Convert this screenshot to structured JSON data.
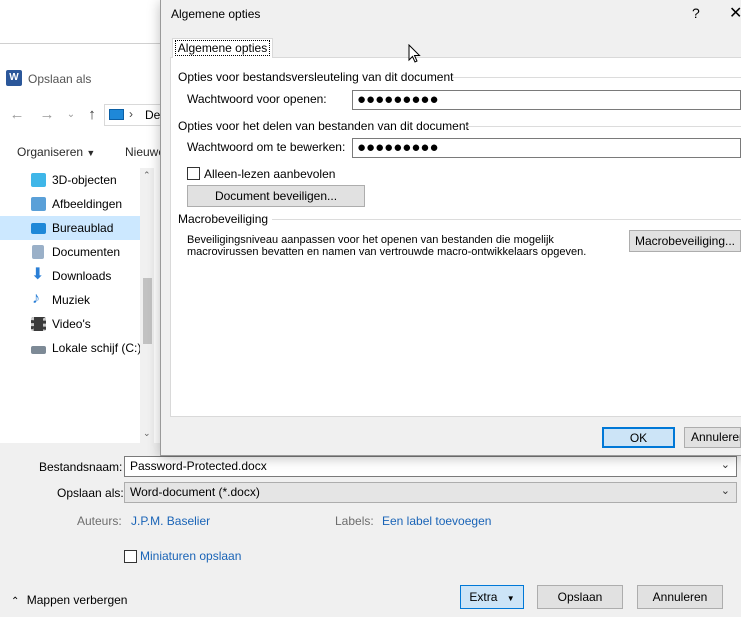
{
  "save_as": {
    "title": "Opslaan als",
    "address_text": "Dez",
    "toolbar": {
      "organize": "Organiseren",
      "new_folder": "Nieuwe"
    },
    "tree": [
      {
        "label": "3D-objecten",
        "icon": "3d-objects-icon",
        "color": "#3fb6e8"
      },
      {
        "label": "Afbeeldingen",
        "icon": "pictures-icon",
        "color": "#5aa0d8"
      },
      {
        "label": "Bureaublad",
        "icon": "desktop-icon",
        "color": "#1e88d8",
        "selected": true
      },
      {
        "label": "Documenten",
        "icon": "documents-icon",
        "color": "#9ab0c8"
      },
      {
        "label": "Downloads",
        "icon": "downloads-icon",
        "color": "#2a7fd6"
      },
      {
        "label": "Muziek",
        "icon": "music-icon",
        "color": "#2a7fd6"
      },
      {
        "label": "Video's",
        "icon": "videos-icon",
        "color": "#3a3a3a"
      },
      {
        "label": "Lokale schijf (C:)",
        "icon": "drive-icon",
        "color": "#7d8a96"
      }
    ],
    "filename_label": "Bestandsnaam:",
    "filename_value": "Password-Protected.docx",
    "savetype_label": "Opslaan als:",
    "savetype_value": "Word-document (*.docx)",
    "authors_label": "Auteurs:",
    "authors_value": "J.P.M. Baselier",
    "labels_label": "Labels:",
    "labels_value": "Een label toevoegen",
    "thumbnails_label": "Miniaturen opslaan",
    "hide_folders": "Mappen verbergen",
    "extra_button": "Extra",
    "save_button": "Opslaan",
    "cancel_button": "Annuleren"
  },
  "dialog": {
    "title": "Algemene opties",
    "help": "?",
    "close": "✕",
    "tab": "Algemene opties",
    "encrypt_group": "Opties voor bestandsversleuteling van dit document",
    "open_pwd_label": "Wachtwoord voor openen:",
    "open_pwd_value": "●●●●●●●●●",
    "share_group": "Opties voor het delen van bestanden van dit document",
    "modify_pwd_label": "Wachtwoord om te bewerken:",
    "modify_pwd_value": "●●●●●●●●●",
    "readonly_label": "Alleen-lezen aanbevolen",
    "protect_button": "Document beveiligen...",
    "macro_group": "Macrobeveiliging",
    "macro_desc_1": "Beveiligingsniveau aanpassen voor het openen van bestanden die mogelijk",
    "macro_desc_2": "macrovirussen bevatten en namen van vertrouwde macro-ontwikkelaars opgeven.",
    "macro_button": "Macrobeveiliging...",
    "ok_button": "OK",
    "cancel_button": "Annuleren"
  }
}
